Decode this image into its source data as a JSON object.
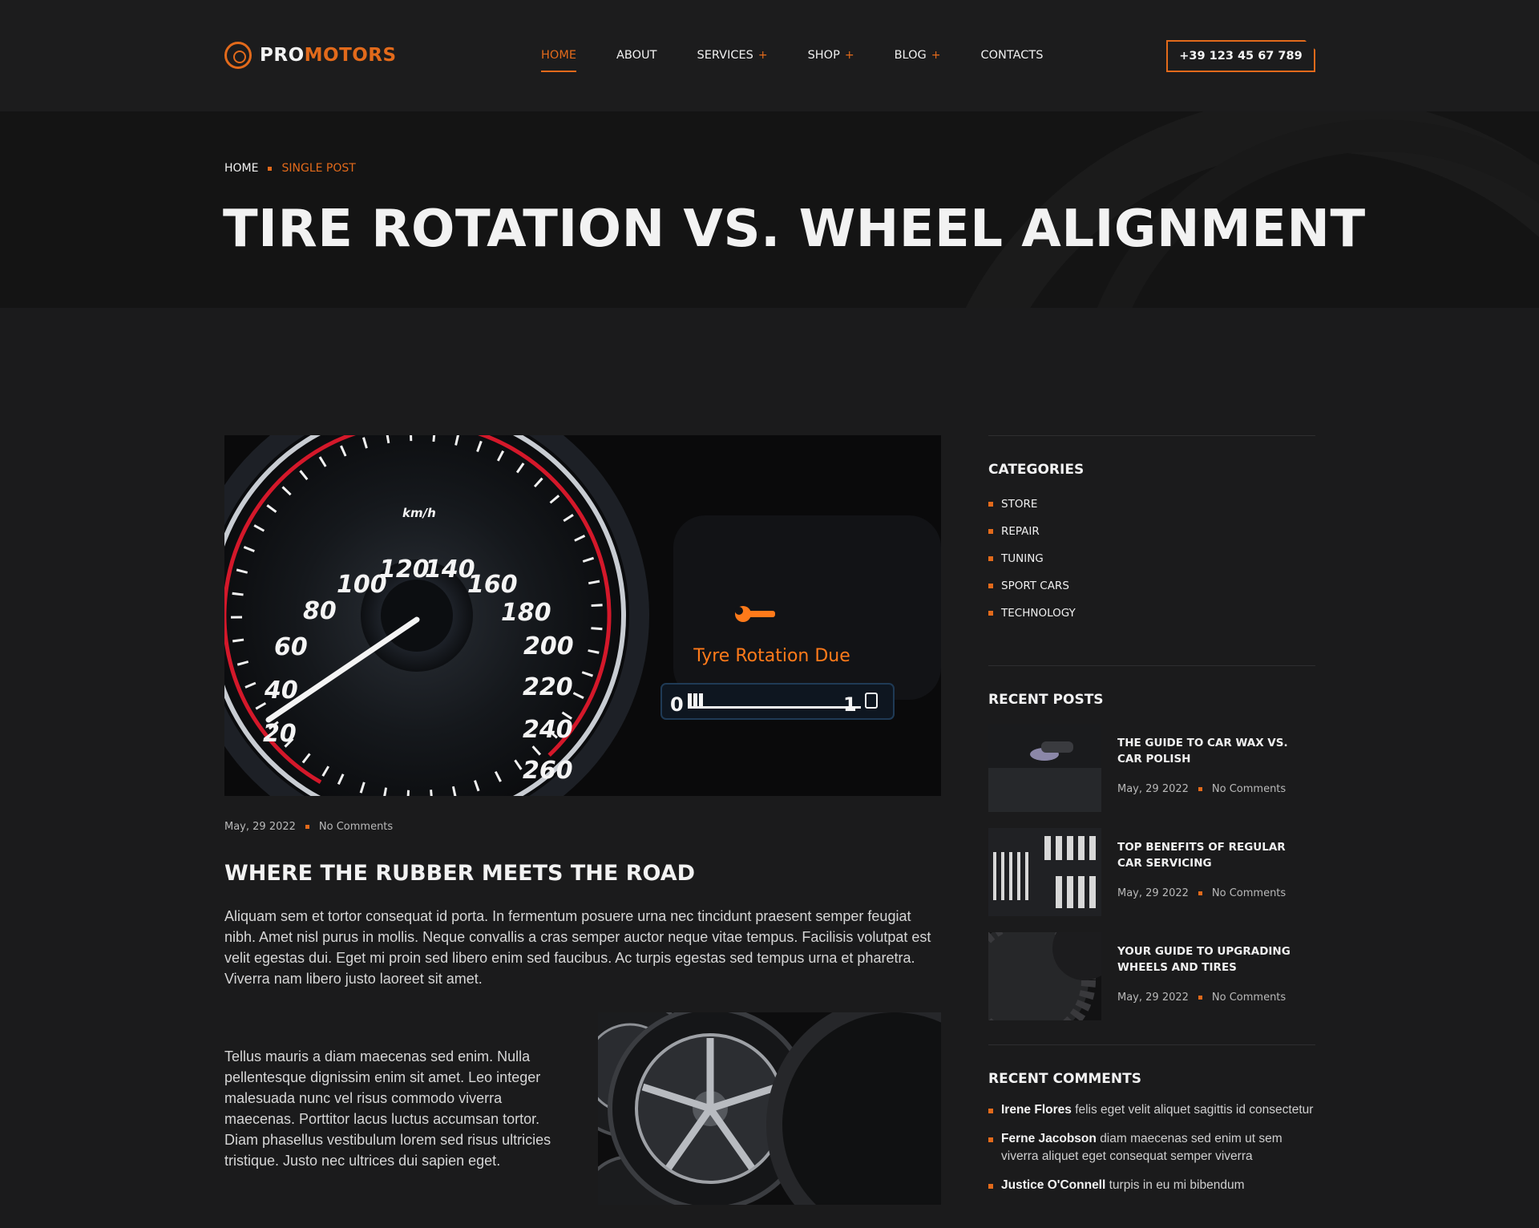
{
  "brand": {
    "part1": "PRO",
    "part2": "MOTORS"
  },
  "nav": [
    {
      "label": "HOME",
      "active": true,
      "has_sub": false
    },
    {
      "label": "ABOUT",
      "active": false,
      "has_sub": false
    },
    {
      "label": "SERVICES",
      "active": false,
      "has_sub": true
    },
    {
      "label": "SHOP",
      "active": false,
      "has_sub": true
    },
    {
      "label": "BLOG",
      "active": false,
      "has_sub": true
    },
    {
      "label": "CONTACTS",
      "active": false,
      "has_sub": false
    }
  ],
  "nav_plus": "+",
  "phone": "+39 123 45 67 789",
  "breadcrumb": {
    "home": "HOME",
    "current": "SINGLE POST"
  },
  "hero_title": "TIRE ROTATION VS. WHEEL ALIGNMENT",
  "post": {
    "image_text": {
      "speeds": [
        "20",
        "40",
        "60",
        "80",
        "100",
        "120",
        "140",
        "160",
        "180",
        "200",
        "220",
        "240",
        "260"
      ],
      "unit": "km/h",
      "warning": "Tyre Rotation Due",
      "gauge_left": "0",
      "gauge_right": "1"
    },
    "date": "May, 29 2022",
    "comments": "No Comments",
    "heading": "WHERE THE RUBBER MEETS THE ROAD",
    "paragraph1": "Aliquam sem et tortor consequat id porta. In fermentum posuere urna nec tincidunt praesent semper feugiat nibh. Amet nisl purus in mollis. Neque convallis a cras semper auctor neque vitae tempus. Facilisis volutpat est velit egestas dui. Eget mi proin sed libero enim sed faucibus. Ac turpis egestas sed tempus urna et pharetra. Viverra nam libero justo laoreet sit amet.",
    "paragraph2": "Tellus mauris a diam maecenas sed enim. Nulla pellentesque dignissim enim sit amet. Leo integer malesuada nunc vel risus commodo viverra maecenas. Porttitor lacus luctus accumsan tortor. Diam phasellus vestibulum lorem sed risus ultricies tristique. Justo nec ultrices dui sapien eget."
  },
  "sidebar": {
    "categories_title": "CATEGORIES",
    "categories": [
      "STORE",
      "REPAIR",
      "TUNING",
      "SPORT CARS",
      "TECHNOLOGY"
    ],
    "recent_posts_title": "RECENT POSTS",
    "recent_posts": [
      {
        "title": "THE GUIDE TO CAR WAX VS. CAR POLISH",
        "date": "May, 29 2022",
        "comments": "No Comments"
      },
      {
        "title": "TOP BENEFITS OF REGULAR CAR SERVICING",
        "date": "May, 29 2022",
        "comments": "No Comments"
      },
      {
        "title": "YOUR GUIDE TO UPGRADING WHEELS AND TIRES",
        "date": "May, 29 2022",
        "comments": "No Comments"
      }
    ],
    "recent_comments_title": "RECENT COMMENTS",
    "recent_comments": [
      {
        "author": "Irene Flores",
        "text": "felis eget velit aliquet sagittis id consectetur"
      },
      {
        "author": "Ferne Jacobson",
        "text": "diam maecenas sed enim ut sem viverra aliquet eget consequat semper viverra"
      },
      {
        "author": "Justice O'Connell",
        "text": "turpis in eu mi bibendum"
      }
    ]
  },
  "colors": {
    "accent": "#e26a1b",
    "background": "#1b1b1c",
    "hero": "#141414"
  }
}
